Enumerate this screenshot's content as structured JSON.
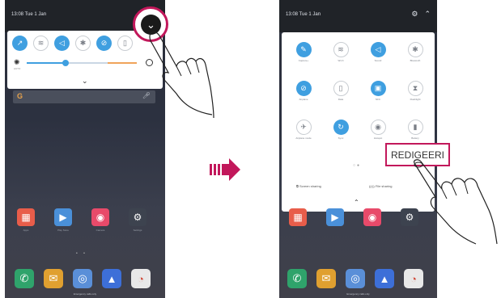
{
  "left_screen": {
    "status_text": "13:08 Tue 1 Jan",
    "expand_icon": "chevron-down-icon",
    "quick_tiles": [
      {
        "icon": "↗",
        "state": "on"
      },
      {
        "icon": "≋",
        "state": "off"
      },
      {
        "icon": "◁",
        "state": "on"
      },
      {
        "icon": "✱",
        "state": "off"
      },
      {
        "icon": "⊘",
        "state": "on"
      },
      {
        "icon": "▯",
        "state": "off"
      }
    ],
    "brightness_value": 0.35,
    "auto_label": "AUTO",
    "apps_row": [
      {
        "label": "Apps",
        "icon": "▦",
        "color": "#e85d4a"
      },
      {
        "label": "Play Store",
        "icon": "▶",
        "color": "#4a90d9"
      },
      {
        "label": "Camera",
        "icon": "◉",
        "color": "#e84a6a"
      },
      {
        "label": "Settings",
        "icon": "⚙",
        "color": "#3d434f"
      }
    ],
    "dock": [
      {
        "icon": "✆",
        "color": "#2fa36b"
      },
      {
        "icon": "✉",
        "color": "#e0a030"
      },
      {
        "icon": "◎",
        "color": "#5a8fd8"
      },
      {
        "icon": "▲",
        "color": "#3d6fd8"
      },
      {
        "icon": "◔",
        "color": "#e8e8e8"
      }
    ],
    "emergency_text": "Emergency calls only"
  },
  "right_screen": {
    "status_text": "13:08 Tue 1 Jan",
    "tiles": [
      {
        "label": "Capture+",
        "icon": "✎",
        "state": "on"
      },
      {
        "label": "Wi-Fi",
        "icon": "≋",
        "state": "off"
      },
      {
        "label": "Sound",
        "icon": "◁",
        "state": "on"
      },
      {
        "label": "Bluetooth",
        "icon": "✱",
        "state": "off"
      },
      {
        "label": "Airplane",
        "icon": "⊘",
        "state": "on"
      },
      {
        "label": "Data",
        "icon": "▯",
        "state": "off"
      },
      {
        "label": "NFC",
        "icon": "▣",
        "state": "on"
      },
      {
        "label": "Flashlight",
        "icon": "⧗",
        "state": "off"
      },
      {
        "label": "Airplane mode",
        "icon": "✈",
        "state": "off"
      },
      {
        "label": "Sync",
        "icon": "↻",
        "state": "on"
      },
      {
        "label": "Hotspot",
        "icon": "◉",
        "state": "off"
      },
      {
        "label": "Battery",
        "icon": "▮",
        "state": "off"
      }
    ],
    "screen_sharing": "Screen sharing",
    "file_sharing": "File sharing",
    "emergency_text": "Emergency calls only"
  },
  "edit_button": "REDIGEERI",
  "colors": {
    "accent": "#3f9fe0",
    "callout": "#c2185b",
    "arrow": "#c2185b"
  }
}
